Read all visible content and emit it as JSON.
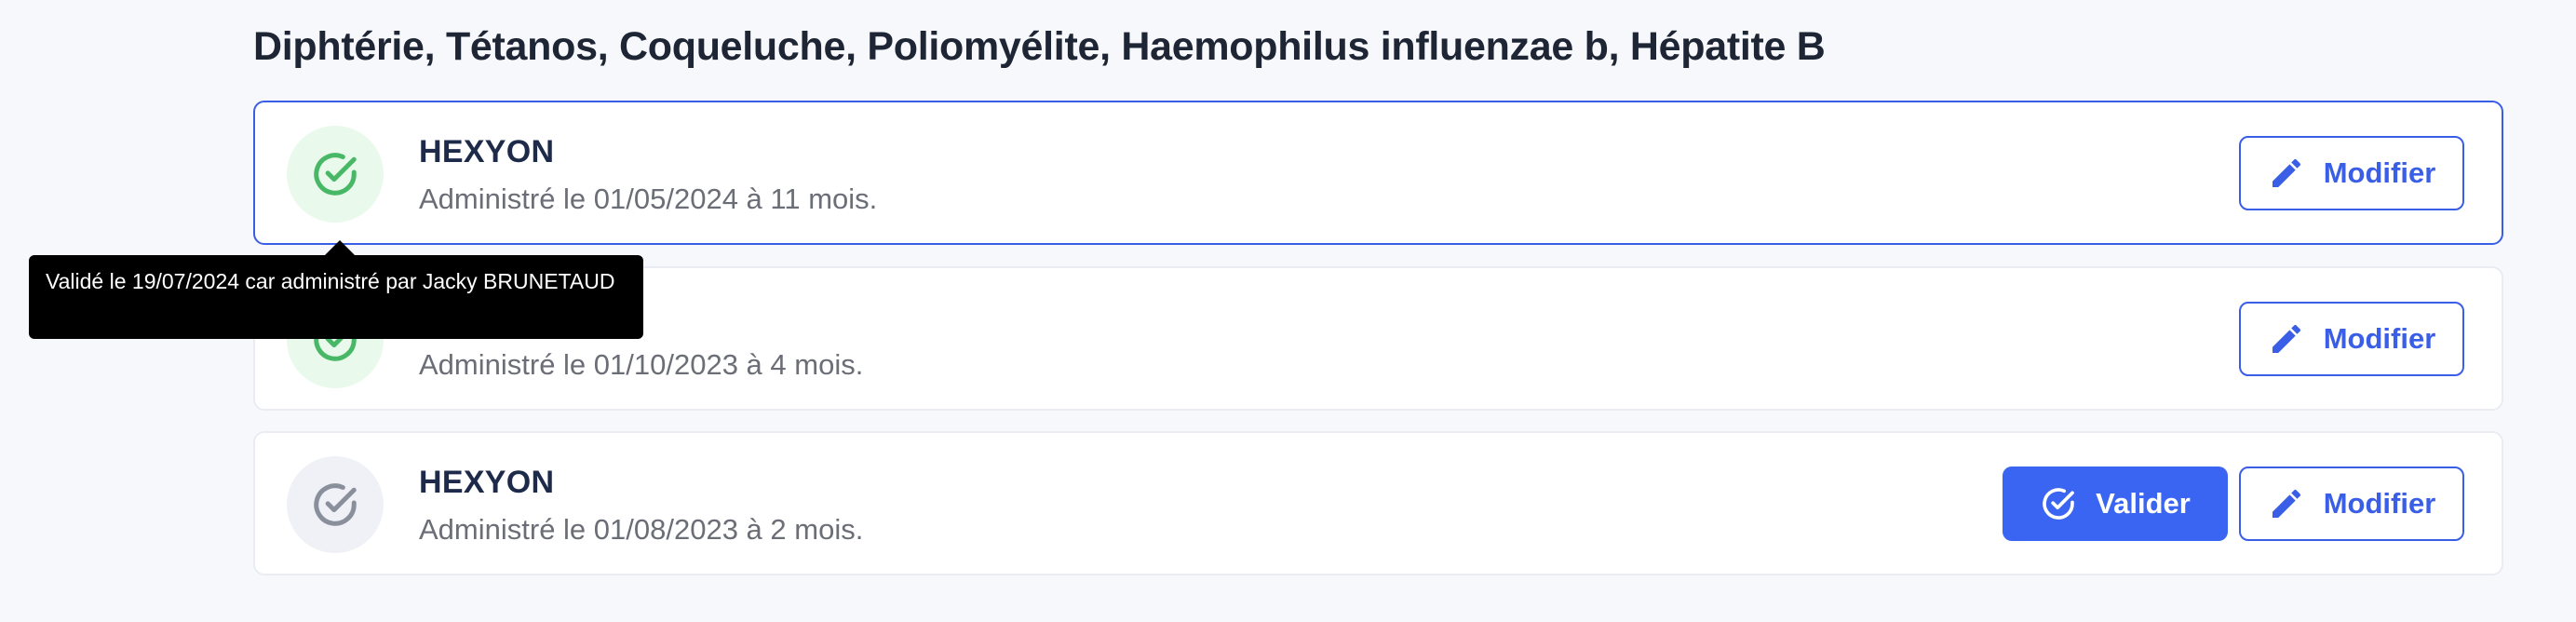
{
  "section": {
    "title": "Diphtérie, Tétanos, Coqueluche, Poliomyélite, Haemophilus influenzae b, Hépatite B"
  },
  "colors": {
    "accent": "#3a5ee6",
    "validated_green": "#48b866",
    "validated_bg": "#e9f9ec",
    "pending_gray": "#8a8f9c",
    "pending_bg": "#eff1f6"
  },
  "vaccinations": [
    {
      "name": "HEXYON",
      "detail": "Administré le 01/05/2024 à 11 mois.",
      "status": "validated",
      "icon": "check-circle-icon",
      "edit_label": "Modifier"
    },
    {
      "name": "",
      "detail": "Administré le 01/10/2023 à 4 mois.",
      "status": "validated",
      "icon": "check-circle-icon",
      "edit_label": "Modifier"
    },
    {
      "name": "HEXYON",
      "detail": "Administré le 01/08/2023 à 2 mois.",
      "status": "pending",
      "icon": "check-circle-icon",
      "validate_label": "Valider",
      "edit_label": "Modifier"
    }
  ],
  "tooltip": {
    "text": "Validé le 19/07/2024 car administré par Jacky BRUNETAUD"
  },
  "icons": {
    "edit": "pencil-icon",
    "validate": "check-circle-icon"
  }
}
